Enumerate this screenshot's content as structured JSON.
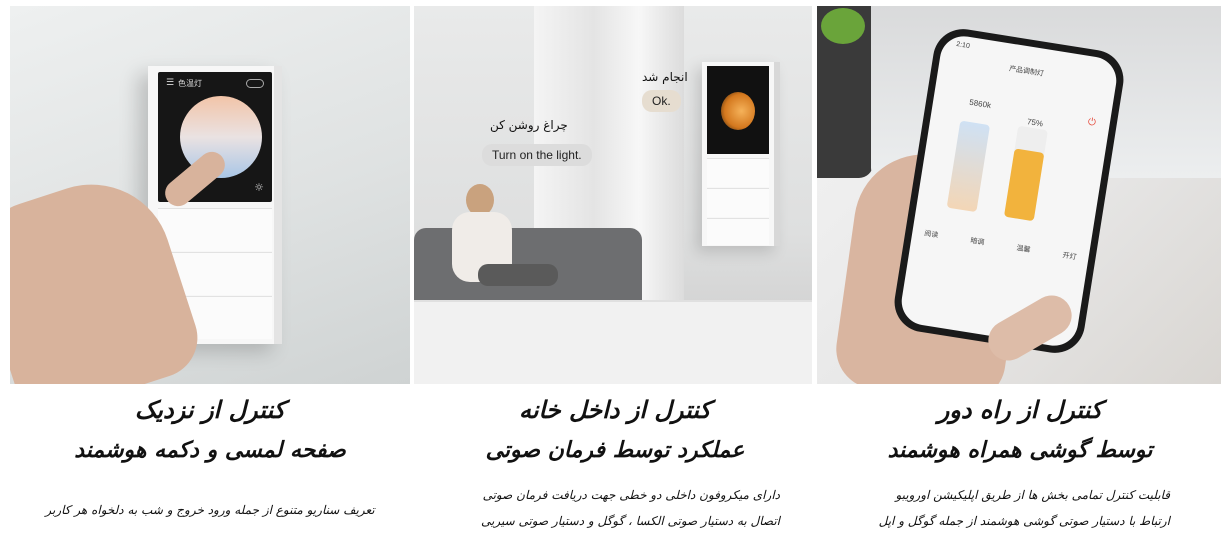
{
  "panels": [
    {
      "title": "کنترل از نزدیک",
      "subtitle": "صفحه لمسی و دکمه هوشمند",
      "description_lines": [
        "تعریف سناریو متنوع از جمله ورود خروج و شب به دلخواه هر کاربر"
      ],
      "device_screen_label": "色温灯"
    },
    {
      "title": "کنترل از داخل خانه",
      "subtitle": "عملکرد توسط فرمان صوتی",
      "description_lines": [
        "دارای میکروفون داخلی دو خطی جهت دریافت فرمان صوتی",
        "اتصال به دستیار صوتی الکسا ، گوگل و دستیار صوتی سیریی"
      ],
      "speech_command_fa": "چراغ روشن کن",
      "speech_command_en": "Turn on the light.",
      "response_fa": "انجام شد",
      "response_en": "Ok."
    },
    {
      "title": "کنترل از راه دور",
      "subtitle": "توسط گوشی همراه هوشمند",
      "description_lines": [
        "قابلیت کنترل تمامی بخش ها از طریق اپلیکیشن اورویبو",
        "ارتباط با دستیار صوتی گوشی هوشمند از جمله گوگل و اپل"
      ],
      "phone": {
        "time": "2:10",
        "title": "产品调制灯",
        "color_temp": "5860k",
        "brightness": "75%",
        "brightness_level": 0.75,
        "modes": [
          "阅读",
          "暗调",
          "温馨",
          "开灯"
        ]
      }
    }
  ],
  "colors": {
    "text": "#111111",
    "warm": "#f2b33d",
    "cool": "#a9c6e6"
  }
}
